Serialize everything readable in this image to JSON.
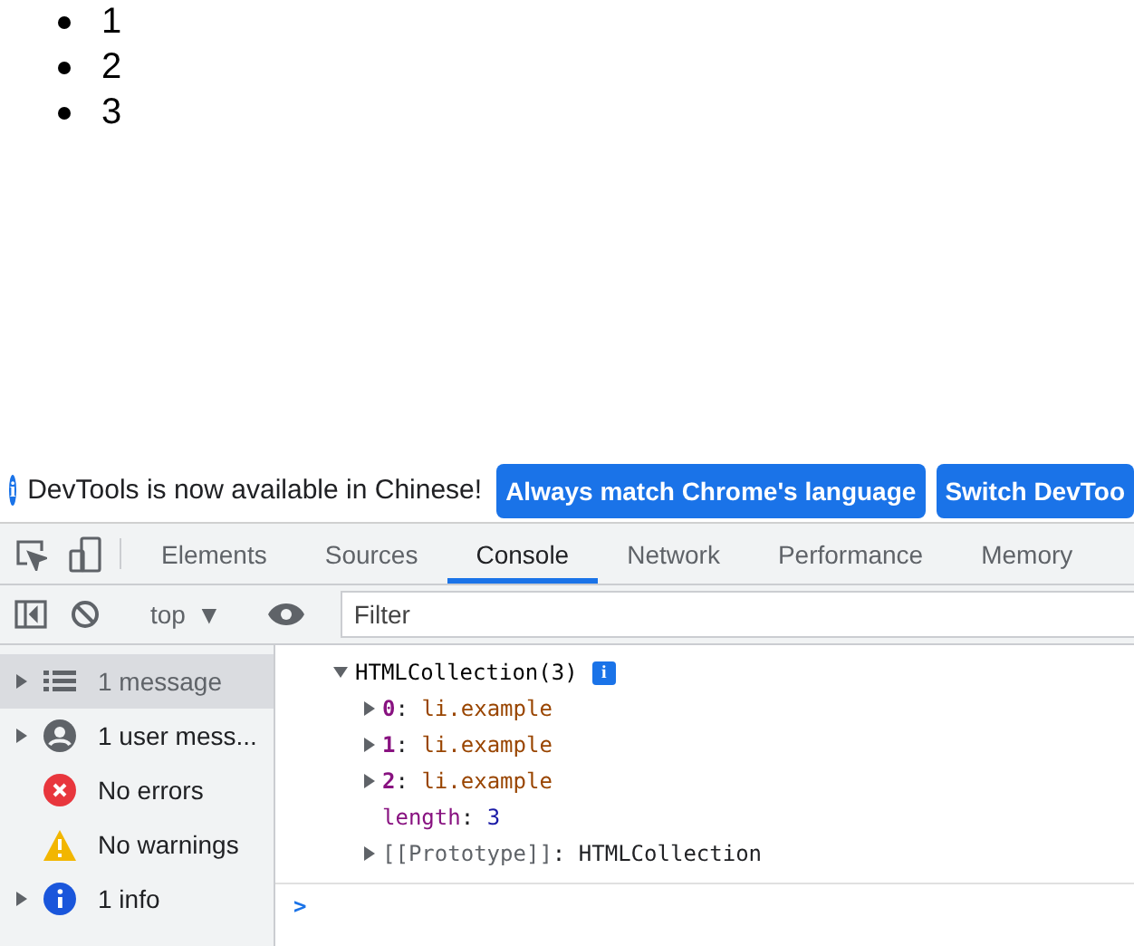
{
  "page_list": [
    "1",
    "2",
    "3"
  ],
  "infobar": {
    "icon": "i",
    "message": "DevTools is now available in Chinese!",
    "buttons": [
      "Always match Chrome's language",
      "Switch DevToo"
    ]
  },
  "tabs": [
    {
      "label": "Elements",
      "selected": false
    },
    {
      "label": "Sources",
      "selected": false
    },
    {
      "label": "Console",
      "selected": true
    },
    {
      "label": "Network",
      "selected": false
    },
    {
      "label": "Performance",
      "selected": false
    },
    {
      "label": "Memory",
      "selected": false
    }
  ],
  "console_toolbar": {
    "context": "top",
    "context_caret": "▼",
    "filter_placeholder": "Filter"
  },
  "sidebar": [
    {
      "label": "1 message",
      "kind": "messages",
      "expandable": true,
      "selected": true
    },
    {
      "label": "1 user mess...",
      "kind": "user",
      "expandable": true,
      "selected": false
    },
    {
      "label": "No errors",
      "kind": "error",
      "expandable": false,
      "selected": false
    },
    {
      "label": "No warnings",
      "kind": "warning",
      "expandable": false,
      "selected": false
    },
    {
      "label": "1 info",
      "kind": "info",
      "expandable": true,
      "selected": false
    }
  ],
  "console": {
    "object": {
      "label": "HTMLCollection(3)",
      "expanded": true,
      "badge": "i",
      "children": [
        {
          "key": "0",
          "sep": ":",
          "value": "li.example",
          "kind": "index"
        },
        {
          "key": "1",
          "sep": ":",
          "value": "li.example",
          "kind": "index"
        },
        {
          "key": "2",
          "sep": ":",
          "value": "li.example",
          "kind": "index"
        },
        {
          "key": "length",
          "sep": ":",
          "value": "3",
          "kind": "prop"
        },
        {
          "key": "[[Prototype]]",
          "sep": ":",
          "value": "HTMLCollection",
          "kind": "proto"
        }
      ]
    },
    "prompt": ">"
  }
}
